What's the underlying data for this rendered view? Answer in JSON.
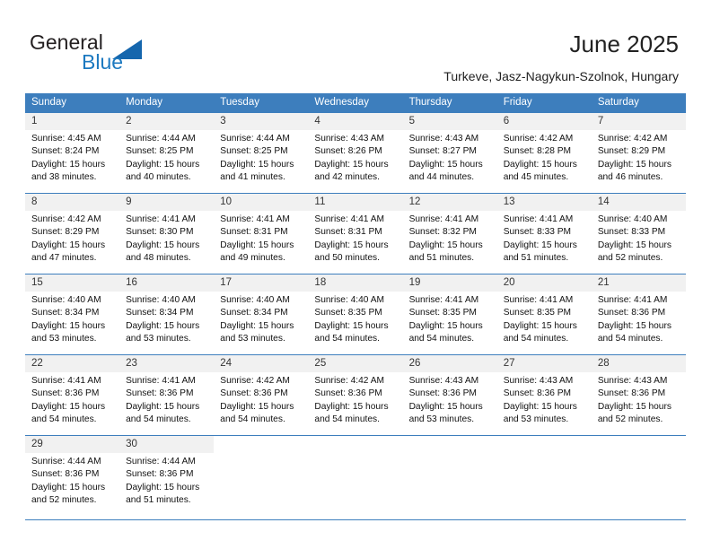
{
  "brand": {
    "name_part1": "General",
    "name_part2": "Blue",
    "triangle_color": "#1566ad",
    "blue_text_color": "#1c79c0"
  },
  "header": {
    "title": "June 2025",
    "location": "Turkeve, Jasz-Nagykun-Szolnok, Hungary",
    "header_bg": "#3d7ebd",
    "daynum_bg": "#f1f1f1"
  },
  "calendar": {
    "weekday_headers": [
      "Sunday",
      "Monday",
      "Tuesday",
      "Wednesday",
      "Thursday",
      "Friday",
      "Saturday"
    ],
    "weeks": [
      [
        {
          "day": "1",
          "detail": "Sunrise: 4:45 AM\nSunset: 8:24 PM\nDaylight: 15 hours\nand 38 minutes."
        },
        {
          "day": "2",
          "detail": "Sunrise: 4:44 AM\nSunset: 8:25 PM\nDaylight: 15 hours\nand 40 minutes."
        },
        {
          "day": "3",
          "detail": "Sunrise: 4:44 AM\nSunset: 8:25 PM\nDaylight: 15 hours\nand 41 minutes."
        },
        {
          "day": "4",
          "detail": "Sunrise: 4:43 AM\nSunset: 8:26 PM\nDaylight: 15 hours\nand 42 minutes."
        },
        {
          "day": "5",
          "detail": "Sunrise: 4:43 AM\nSunset: 8:27 PM\nDaylight: 15 hours\nand 44 minutes."
        },
        {
          "day": "6",
          "detail": "Sunrise: 4:42 AM\nSunset: 8:28 PM\nDaylight: 15 hours\nand 45 minutes."
        },
        {
          "day": "7",
          "detail": "Sunrise: 4:42 AM\nSunset: 8:29 PM\nDaylight: 15 hours\nand 46 minutes."
        }
      ],
      [
        {
          "day": "8",
          "detail": "Sunrise: 4:42 AM\nSunset: 8:29 PM\nDaylight: 15 hours\nand 47 minutes."
        },
        {
          "day": "9",
          "detail": "Sunrise: 4:41 AM\nSunset: 8:30 PM\nDaylight: 15 hours\nand 48 minutes."
        },
        {
          "day": "10",
          "detail": "Sunrise: 4:41 AM\nSunset: 8:31 PM\nDaylight: 15 hours\nand 49 minutes."
        },
        {
          "day": "11",
          "detail": "Sunrise: 4:41 AM\nSunset: 8:31 PM\nDaylight: 15 hours\nand 50 minutes."
        },
        {
          "day": "12",
          "detail": "Sunrise: 4:41 AM\nSunset: 8:32 PM\nDaylight: 15 hours\nand 51 minutes."
        },
        {
          "day": "13",
          "detail": "Sunrise: 4:41 AM\nSunset: 8:33 PM\nDaylight: 15 hours\nand 51 minutes."
        },
        {
          "day": "14",
          "detail": "Sunrise: 4:40 AM\nSunset: 8:33 PM\nDaylight: 15 hours\nand 52 minutes."
        }
      ],
      [
        {
          "day": "15",
          "detail": "Sunrise: 4:40 AM\nSunset: 8:34 PM\nDaylight: 15 hours\nand 53 minutes."
        },
        {
          "day": "16",
          "detail": "Sunrise: 4:40 AM\nSunset: 8:34 PM\nDaylight: 15 hours\nand 53 minutes."
        },
        {
          "day": "17",
          "detail": "Sunrise: 4:40 AM\nSunset: 8:34 PM\nDaylight: 15 hours\nand 53 minutes."
        },
        {
          "day": "18",
          "detail": "Sunrise: 4:40 AM\nSunset: 8:35 PM\nDaylight: 15 hours\nand 54 minutes."
        },
        {
          "day": "19",
          "detail": "Sunrise: 4:41 AM\nSunset: 8:35 PM\nDaylight: 15 hours\nand 54 minutes."
        },
        {
          "day": "20",
          "detail": "Sunrise: 4:41 AM\nSunset: 8:35 PM\nDaylight: 15 hours\nand 54 minutes."
        },
        {
          "day": "21",
          "detail": "Sunrise: 4:41 AM\nSunset: 8:36 PM\nDaylight: 15 hours\nand 54 minutes."
        }
      ],
      [
        {
          "day": "22",
          "detail": "Sunrise: 4:41 AM\nSunset: 8:36 PM\nDaylight: 15 hours\nand 54 minutes."
        },
        {
          "day": "23",
          "detail": "Sunrise: 4:41 AM\nSunset: 8:36 PM\nDaylight: 15 hours\nand 54 minutes."
        },
        {
          "day": "24",
          "detail": "Sunrise: 4:42 AM\nSunset: 8:36 PM\nDaylight: 15 hours\nand 54 minutes."
        },
        {
          "day": "25",
          "detail": "Sunrise: 4:42 AM\nSunset: 8:36 PM\nDaylight: 15 hours\nand 54 minutes."
        },
        {
          "day": "26",
          "detail": "Sunrise: 4:43 AM\nSunset: 8:36 PM\nDaylight: 15 hours\nand 53 minutes."
        },
        {
          "day": "27",
          "detail": "Sunrise: 4:43 AM\nSunset: 8:36 PM\nDaylight: 15 hours\nand 53 minutes."
        },
        {
          "day": "28",
          "detail": "Sunrise: 4:43 AM\nSunset: 8:36 PM\nDaylight: 15 hours\nand 52 minutes."
        }
      ],
      [
        {
          "day": "29",
          "detail": "Sunrise: 4:44 AM\nSunset: 8:36 PM\nDaylight: 15 hours\nand 52 minutes."
        },
        {
          "day": "30",
          "detail": "Sunrise: 4:44 AM\nSunset: 8:36 PM\nDaylight: 15 hours\nand 51 minutes."
        },
        {
          "day": "",
          "detail": ""
        },
        {
          "day": "",
          "detail": ""
        },
        {
          "day": "",
          "detail": ""
        },
        {
          "day": "",
          "detail": ""
        },
        {
          "day": "",
          "detail": ""
        }
      ]
    ]
  }
}
